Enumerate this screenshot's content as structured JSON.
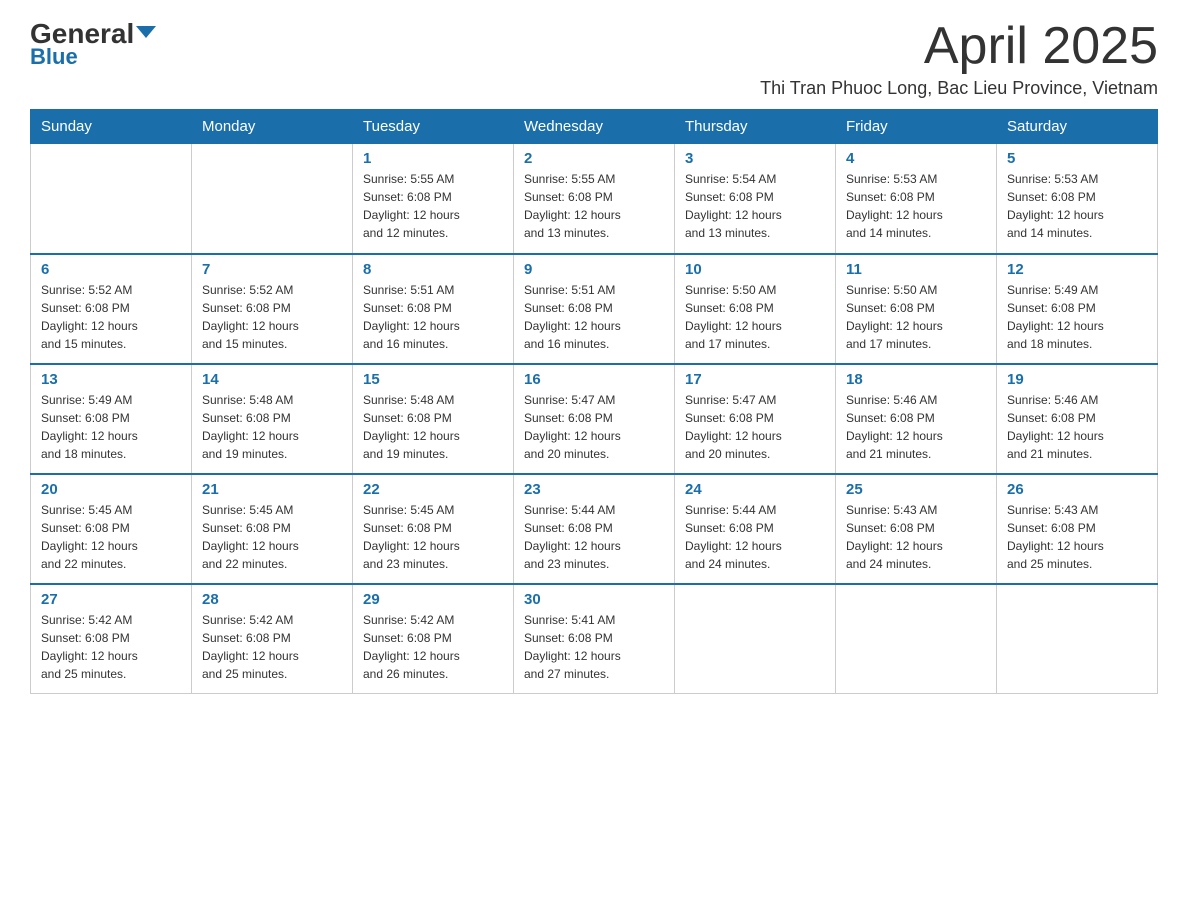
{
  "header": {
    "logo_general": "General",
    "logo_blue": "Blue",
    "title": "April 2025",
    "subtitle": "Thi Tran Phuoc Long, Bac Lieu Province, Vietnam"
  },
  "days_of_week": [
    "Sunday",
    "Monday",
    "Tuesday",
    "Wednesday",
    "Thursday",
    "Friday",
    "Saturday"
  ],
  "weeks": [
    [
      {
        "day": "",
        "info": ""
      },
      {
        "day": "",
        "info": ""
      },
      {
        "day": "1",
        "info": "Sunrise: 5:55 AM\nSunset: 6:08 PM\nDaylight: 12 hours\nand 12 minutes."
      },
      {
        "day": "2",
        "info": "Sunrise: 5:55 AM\nSunset: 6:08 PM\nDaylight: 12 hours\nand 13 minutes."
      },
      {
        "day": "3",
        "info": "Sunrise: 5:54 AM\nSunset: 6:08 PM\nDaylight: 12 hours\nand 13 minutes."
      },
      {
        "day": "4",
        "info": "Sunrise: 5:53 AM\nSunset: 6:08 PM\nDaylight: 12 hours\nand 14 minutes."
      },
      {
        "day": "5",
        "info": "Sunrise: 5:53 AM\nSunset: 6:08 PM\nDaylight: 12 hours\nand 14 minutes."
      }
    ],
    [
      {
        "day": "6",
        "info": "Sunrise: 5:52 AM\nSunset: 6:08 PM\nDaylight: 12 hours\nand 15 minutes."
      },
      {
        "day": "7",
        "info": "Sunrise: 5:52 AM\nSunset: 6:08 PM\nDaylight: 12 hours\nand 15 minutes."
      },
      {
        "day": "8",
        "info": "Sunrise: 5:51 AM\nSunset: 6:08 PM\nDaylight: 12 hours\nand 16 minutes."
      },
      {
        "day": "9",
        "info": "Sunrise: 5:51 AM\nSunset: 6:08 PM\nDaylight: 12 hours\nand 16 minutes."
      },
      {
        "day": "10",
        "info": "Sunrise: 5:50 AM\nSunset: 6:08 PM\nDaylight: 12 hours\nand 17 minutes."
      },
      {
        "day": "11",
        "info": "Sunrise: 5:50 AM\nSunset: 6:08 PM\nDaylight: 12 hours\nand 17 minutes."
      },
      {
        "day": "12",
        "info": "Sunrise: 5:49 AM\nSunset: 6:08 PM\nDaylight: 12 hours\nand 18 minutes."
      }
    ],
    [
      {
        "day": "13",
        "info": "Sunrise: 5:49 AM\nSunset: 6:08 PM\nDaylight: 12 hours\nand 18 minutes."
      },
      {
        "day": "14",
        "info": "Sunrise: 5:48 AM\nSunset: 6:08 PM\nDaylight: 12 hours\nand 19 minutes."
      },
      {
        "day": "15",
        "info": "Sunrise: 5:48 AM\nSunset: 6:08 PM\nDaylight: 12 hours\nand 19 minutes."
      },
      {
        "day": "16",
        "info": "Sunrise: 5:47 AM\nSunset: 6:08 PM\nDaylight: 12 hours\nand 20 minutes."
      },
      {
        "day": "17",
        "info": "Sunrise: 5:47 AM\nSunset: 6:08 PM\nDaylight: 12 hours\nand 20 minutes."
      },
      {
        "day": "18",
        "info": "Sunrise: 5:46 AM\nSunset: 6:08 PM\nDaylight: 12 hours\nand 21 minutes."
      },
      {
        "day": "19",
        "info": "Sunrise: 5:46 AM\nSunset: 6:08 PM\nDaylight: 12 hours\nand 21 minutes."
      }
    ],
    [
      {
        "day": "20",
        "info": "Sunrise: 5:45 AM\nSunset: 6:08 PM\nDaylight: 12 hours\nand 22 minutes."
      },
      {
        "day": "21",
        "info": "Sunrise: 5:45 AM\nSunset: 6:08 PM\nDaylight: 12 hours\nand 22 minutes."
      },
      {
        "day": "22",
        "info": "Sunrise: 5:45 AM\nSunset: 6:08 PM\nDaylight: 12 hours\nand 23 minutes."
      },
      {
        "day": "23",
        "info": "Sunrise: 5:44 AM\nSunset: 6:08 PM\nDaylight: 12 hours\nand 23 minutes."
      },
      {
        "day": "24",
        "info": "Sunrise: 5:44 AM\nSunset: 6:08 PM\nDaylight: 12 hours\nand 24 minutes."
      },
      {
        "day": "25",
        "info": "Sunrise: 5:43 AM\nSunset: 6:08 PM\nDaylight: 12 hours\nand 24 minutes."
      },
      {
        "day": "26",
        "info": "Sunrise: 5:43 AM\nSunset: 6:08 PM\nDaylight: 12 hours\nand 25 minutes."
      }
    ],
    [
      {
        "day": "27",
        "info": "Sunrise: 5:42 AM\nSunset: 6:08 PM\nDaylight: 12 hours\nand 25 minutes."
      },
      {
        "day": "28",
        "info": "Sunrise: 5:42 AM\nSunset: 6:08 PM\nDaylight: 12 hours\nand 25 minutes."
      },
      {
        "day": "29",
        "info": "Sunrise: 5:42 AM\nSunset: 6:08 PM\nDaylight: 12 hours\nand 26 minutes."
      },
      {
        "day": "30",
        "info": "Sunrise: 5:41 AM\nSunset: 6:08 PM\nDaylight: 12 hours\nand 27 minutes."
      },
      {
        "day": "",
        "info": ""
      },
      {
        "day": "",
        "info": ""
      },
      {
        "day": "",
        "info": ""
      }
    ]
  ]
}
